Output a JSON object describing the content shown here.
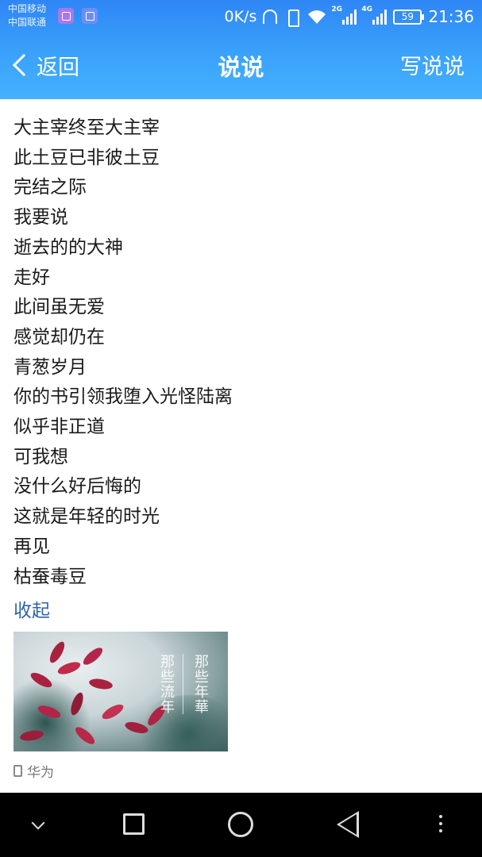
{
  "status_bar": {
    "carrier_1": "中国移动",
    "carrier_2": "中国联通",
    "net_speed": "0K/s",
    "signal_1_type": "2G",
    "signal_2_type": "4G",
    "battery": "59",
    "time": "21:36",
    "icons": [
      "sim-icon",
      "sim-icon",
      "headset-icon",
      "vibrate-icon",
      "wifi-icon",
      "signal-icon",
      "signal-icon",
      "battery-icon"
    ]
  },
  "header": {
    "back_label": "返回",
    "title": "说说",
    "action_label": "写说说",
    "background": "#3a9dfa"
  },
  "post": {
    "lines": [
      "大主宰终至大主宰",
      "此土豆已非彼土豆",
      "完结之际",
      "我要说",
      "逝去的的大神",
      "走好",
      "此间虽无爱",
      "感觉却仍在",
      "青葱岁月",
      "你的书引领我堕入光怪陆离",
      "似乎非正道",
      "可我想",
      "没什么好后悔的",
      "这就是年轻的时光",
      "再见",
      "枯蚕毒豆"
    ],
    "collapse_label": "收起",
    "image_text": [
      "那些年華",
      "那些流年"
    ],
    "device_label": "华为",
    "link_color": "#2f64a8"
  },
  "nav_bar": {
    "icons": [
      "chevron-down-icon",
      "recents-icon",
      "home-icon",
      "back-icon",
      "more-icon"
    ]
  }
}
